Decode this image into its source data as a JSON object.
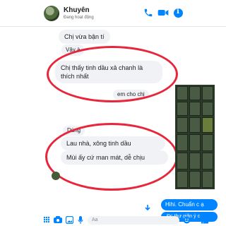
{
  "header": {
    "contact_name": "Khuyên",
    "status": "Đang hoạt động",
    "icons": {
      "call": "phone-icon",
      "video": "video-icon",
      "info": "info-icon"
    }
  },
  "messages": [
    {
      "text": "Chị vừa bận tí"
    },
    {
      "text": "Vậy à"
    },
    {
      "text": "Chị thấy tinh dầu xả chanh là thích nhất"
    },
    {
      "text": "em cho chị"
    },
    {
      "text": "Dùng"
    },
    {
      "text": "Lau nhà, xông tinh dầu"
    },
    {
      "text": "Mùi ấy cứ man mát, dễ chịu"
    }
  ],
  "outgoing": [
    {
      "text": "Hihi. Chuẩn c ạ"
    },
    {
      "text": "Đc thư giãn ý c"
    }
  ],
  "composer": {
    "placeholder": "Aa"
  },
  "colors": {
    "accent": "#0084ff",
    "highlight_ring": "#e8253a",
    "incoming_bubble": "#f0f2f5"
  }
}
